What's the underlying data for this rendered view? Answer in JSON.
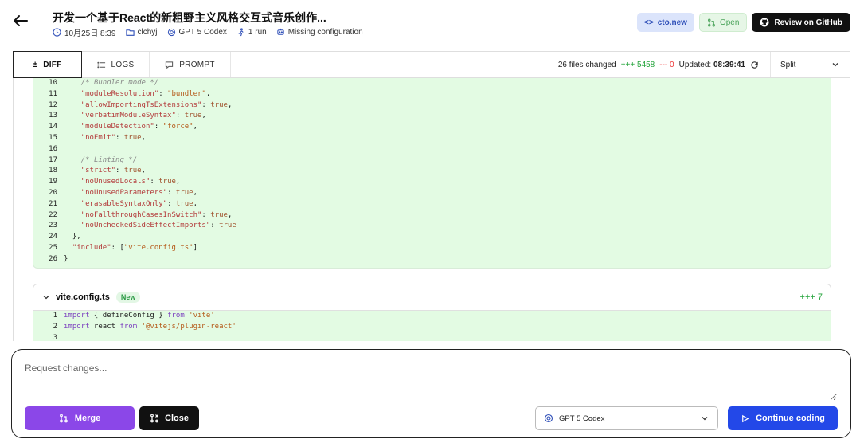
{
  "header": {
    "title": "开发一个基于React的新粗野主义风格交互式音乐创作...",
    "date": "10月25日 8:39",
    "user": "clchyj",
    "model": "GPT 5 Codex",
    "runs": "1 run",
    "config_status": "Missing configuration",
    "cto_label": "cto.new",
    "open_label": "Open",
    "github_label": "Review on GitHub"
  },
  "tabs": [
    {
      "label": "DIFF"
    },
    {
      "label": "LOGS"
    },
    {
      "label": "PROMPT"
    }
  ],
  "stats": {
    "files_changed": "26 files changed",
    "additions": "+++ 5458",
    "deletions": "--- 0",
    "updated_label": "Updated:",
    "updated_time": "08:39:41"
  },
  "view_mode": "Split",
  "diff": {
    "file1_lines": [
      {
        "n": "10",
        "html": "    <span class='tk-cmt'>/* Bundler mode */</span>"
      },
      {
        "n": "11",
        "html": "    <span class='tk-key'>\"moduleResolution\"</span>: <span class='tk-str'>\"bundler\"</span>,"
      },
      {
        "n": "12",
        "html": "    <span class='tk-key'>\"allowImportingTsExtensions\"</span>: <span class='tk-kw'>true</span>,"
      },
      {
        "n": "13",
        "html": "    <span class='tk-key'>\"verbatimModuleSyntax\"</span>: <span class='tk-kw'>true</span>,"
      },
      {
        "n": "14",
        "html": "    <span class='tk-key'>\"moduleDetection\"</span>: <span class='tk-str'>\"force\"</span>,"
      },
      {
        "n": "15",
        "html": "    <span class='tk-key'>\"noEmit\"</span>: <span class='tk-kw'>true</span>,"
      },
      {
        "n": "16",
        "html": ""
      },
      {
        "n": "17",
        "html": "    <span class='tk-cmt'>/* Linting */</span>"
      },
      {
        "n": "18",
        "html": "    <span class='tk-key'>\"strict\"</span>: <span class='tk-kw'>true</span>,"
      },
      {
        "n": "19",
        "html": "    <span class='tk-key'>\"noUnusedLocals\"</span>: <span class='tk-kw'>true</span>,"
      },
      {
        "n": "20",
        "html": "    <span class='tk-key'>\"noUnusedParameters\"</span>: <span class='tk-kw'>true</span>,"
      },
      {
        "n": "21",
        "html": "    <span class='tk-key'>\"erasableSyntaxOnly\"</span>: <span class='tk-kw'>true</span>,"
      },
      {
        "n": "22",
        "html": "    <span class='tk-key'>\"noFallthroughCasesInSwitch\"</span>: <span class='tk-kw'>true</span>,"
      },
      {
        "n": "23",
        "html": "    <span class='tk-key'>\"noUncheckedSideEffectImports\"</span>: <span class='tk-kw'>true</span>"
      },
      {
        "n": "24",
        "html": "  },"
      },
      {
        "n": "25",
        "html": "  <span class='tk-key'>\"include\"</span>: [<span class='tk-str'>\"vite.config.ts\"</span>]"
      },
      {
        "n": "26",
        "html": "}"
      }
    ],
    "file2_name": "vite.config.ts",
    "file2_badge": "New",
    "file2_count": "+++ 7",
    "file2_lines": [
      {
        "n": "1",
        "html": "<span class='tk-import'>import</span> { defineConfig } <span class='tk-import'>from</span> <span class='tk-str'>'vite'</span>"
      },
      {
        "n": "2",
        "html": "<span class='tk-import'>import</span> react <span class='tk-import'>from</span> <span class='tk-str'>'@vitejs/plugin-react'</span>"
      },
      {
        "n": "3",
        "html": ""
      }
    ]
  },
  "request": {
    "placeholder": "Request changes...",
    "merge_label": "Merge",
    "close_label": "Close",
    "model_value": "GPT 5 Codex",
    "continue_label": "Continue coding"
  },
  "colors": {
    "accent_blue": "#2348e8",
    "merge_purple": "#8b47e8",
    "add_green": "#22a339",
    "del_red": "#e33333",
    "diff_bg": "#e3fbe3"
  }
}
